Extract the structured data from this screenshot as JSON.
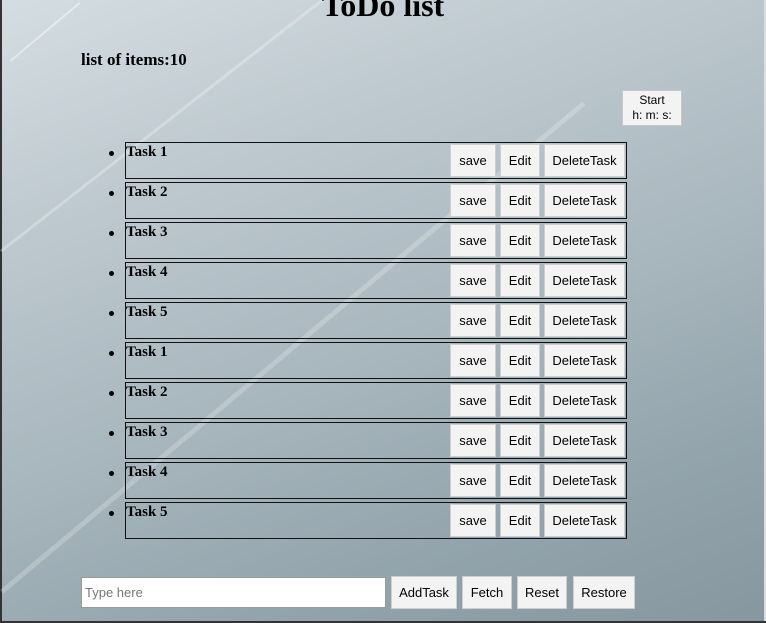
{
  "title": "ToDo list",
  "count_label": "list of items:10",
  "timer": {
    "start_label": "Start",
    "time_label": "h: m: s:"
  },
  "tasks": [
    {
      "name": "Task 1",
      "save": "save",
      "edit": "Edit",
      "delete": "DeleteTask"
    },
    {
      "name": "Task 2",
      "save": "save",
      "edit": "Edit",
      "delete": "DeleteTask"
    },
    {
      "name": "Task 3",
      "save": "save",
      "edit": "Edit",
      "delete": "DeleteTask"
    },
    {
      "name": "Task 4",
      "save": "save",
      "edit": "Edit",
      "delete": "DeleteTask"
    },
    {
      "name": "Task 5",
      "save": "save",
      "edit": "Edit",
      "delete": "DeleteTask"
    },
    {
      "name": "Task 1",
      "save": "save",
      "edit": "Edit",
      "delete": "DeleteTask"
    },
    {
      "name": "Task 2",
      "save": "save",
      "edit": "Edit",
      "delete": "DeleteTask"
    },
    {
      "name": "Task 3",
      "save": "save",
      "edit": "Edit",
      "delete": "DeleteTask"
    },
    {
      "name": "Task 4",
      "save": "save",
      "edit": "Edit",
      "delete": "DeleteTask"
    },
    {
      "name": "Task 5",
      "save": "save",
      "edit": "Edit",
      "delete": "DeleteTask"
    }
  ],
  "input": {
    "placeholder": "Type here",
    "value": ""
  },
  "actions": {
    "add": "AddTask",
    "fetch": "Fetch",
    "reset": "Reset",
    "restore": "Restore"
  }
}
